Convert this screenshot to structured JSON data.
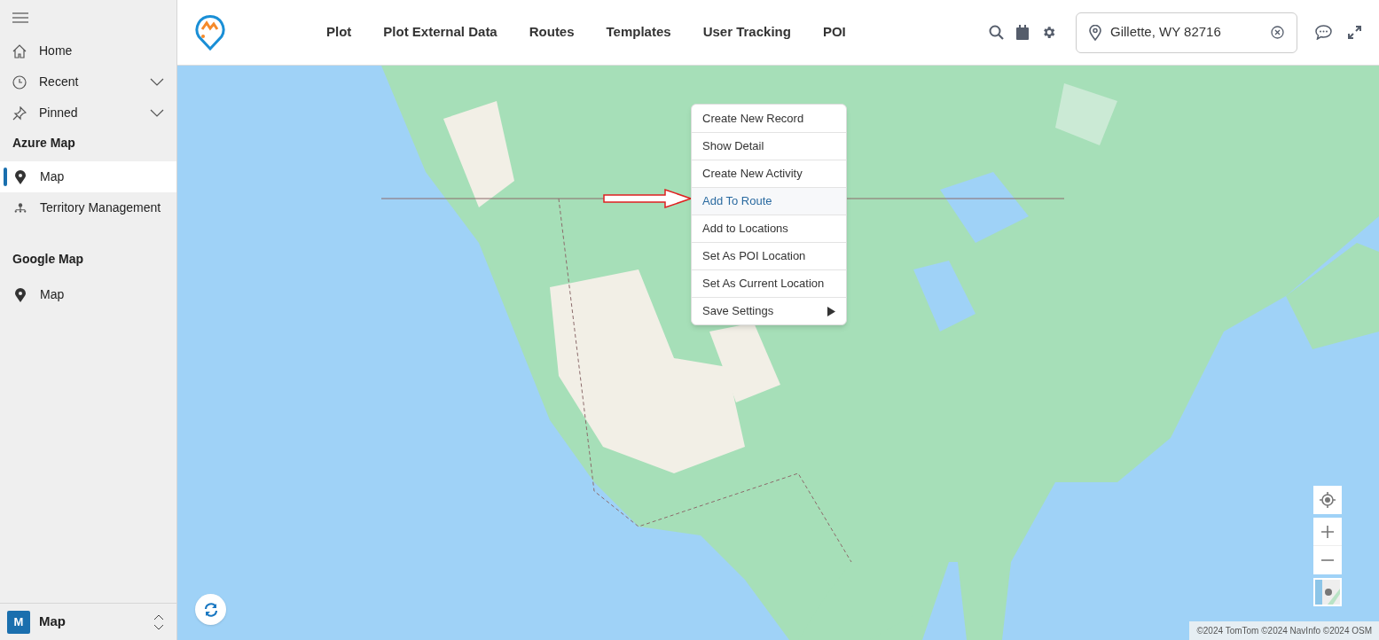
{
  "sidebar": {
    "nav_items": [
      {
        "label": "Home",
        "kind": "link"
      },
      {
        "label": "Recent",
        "kind": "expandable"
      },
      {
        "label": "Pinned",
        "kind": "expandable"
      }
    ],
    "sections": [
      {
        "title": "Azure Map",
        "items": [
          {
            "label": "Map",
            "selected": true
          },
          {
            "label": "Territory Management",
            "selected": false
          }
        ]
      },
      {
        "title": "Google Map",
        "items": [
          {
            "label": "Map",
            "selected": false
          }
        ]
      }
    ],
    "footer": {
      "badge": "M",
      "label": "Map"
    }
  },
  "top_nav": {
    "links": [
      "Plot",
      "Plot External Data",
      "Routes",
      "Templates",
      "User Tracking",
      "POI"
    ],
    "location_field": {
      "value": "Gillette, WY 82716"
    }
  },
  "map": {
    "context_menu": [
      {
        "label": "Create New Record",
        "selected": false,
        "submenu": false
      },
      {
        "label": "Show Detail",
        "selected": false,
        "submenu": false
      },
      {
        "label": "Create New Activity",
        "selected": false,
        "submenu": false
      },
      {
        "label": "Add To Route",
        "selected": true,
        "submenu": false
      },
      {
        "label": "Add to Locations",
        "selected": false,
        "submenu": false
      },
      {
        "label": "Set As POI Location",
        "selected": false,
        "submenu": false
      },
      {
        "label": "Set As Current Location",
        "selected": false,
        "submenu": false
      },
      {
        "label": "Save Settings",
        "selected": false,
        "submenu": true
      }
    ],
    "attribution": "©2024 TomTom ©2024 NavInfo ©2024 OSM"
  }
}
